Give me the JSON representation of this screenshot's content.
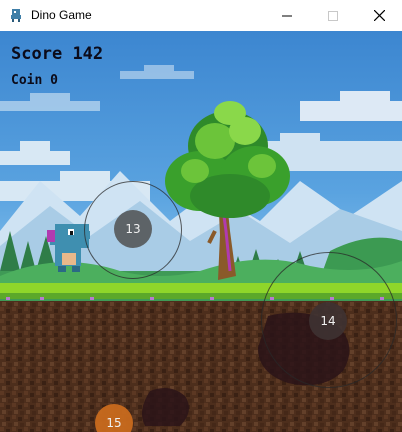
{
  "window": {
    "title": "Dino Game",
    "icon": "dino-app-icon",
    "controls": [
      "minimize",
      "maximize",
      "close"
    ]
  },
  "hud": {
    "score_label": "Score",
    "score_value": "142",
    "coin_label": "Coin",
    "coin_value": "0"
  },
  "targets": [
    {
      "label": "13",
      "color": "#5a5a5a"
    },
    {
      "label": "14",
      "color": "#3e3232"
    },
    {
      "label": "15",
      "color": "#c86a1e"
    }
  ],
  "colors": {
    "sky": "#3f8fd6",
    "grass": "#8fd62a",
    "dirt": "#4a2b1b",
    "dino": "#3f8fb0",
    "tree_leaves": "#3fa82a"
  }
}
